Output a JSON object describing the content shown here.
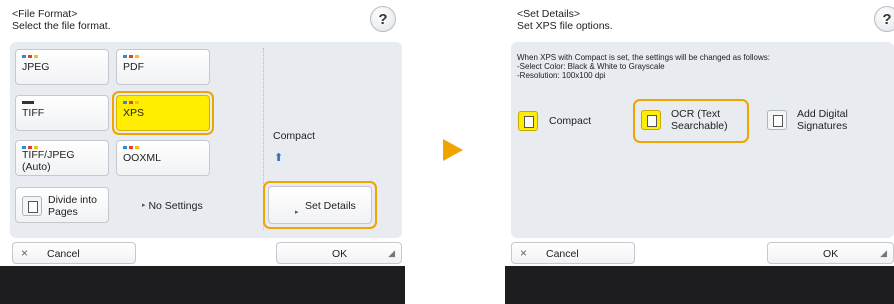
{
  "left": {
    "header_line1": "<File Format>",
    "header_line2": "Select the file format.",
    "help_label": "?",
    "formats": {
      "jpeg": "JPEG",
      "pdf": "PDF",
      "tiff": "TIFF",
      "xps": "XPS",
      "tiff_jpeg_line1": "TIFF/JPEG",
      "tiff_jpeg_line2": "(Auto)",
      "ooxml": "OOXML"
    },
    "divide_label_line1": "Divide into",
    "divide_label_line2": "Pages",
    "divide_value": "No Settings",
    "compact_label": "Compact",
    "set_details_label": "Set Details",
    "cancel_label": "Cancel",
    "ok_label": "OK",
    "cancel_icon": "×"
  },
  "right": {
    "header_line1": "<Set Details>",
    "header_line2": "Set XPS file options.",
    "help_label": "?",
    "info_line1": "When XPS with Compact is set, the settings will be changed as follows:",
    "info_line2": "-Select Color: Black & White to Grayscale",
    "info_line3": "-Resolution: 100x100 dpi",
    "compact_label": "Compact",
    "ocr_line1": "OCR (Text",
    "ocr_line2": "Searchable)",
    "add_sig_line1": "Add Digital",
    "add_sig_line2": "Signatures",
    "cancel_label": "Cancel",
    "ok_label": "OK",
    "cancel_icon": "×"
  },
  "colors": {
    "selected_yellow": "#ffee00",
    "highlight_orange": "#f0a400",
    "panel_gray": "#e8ebef",
    "bottom_bar": "#1d1d1f"
  }
}
